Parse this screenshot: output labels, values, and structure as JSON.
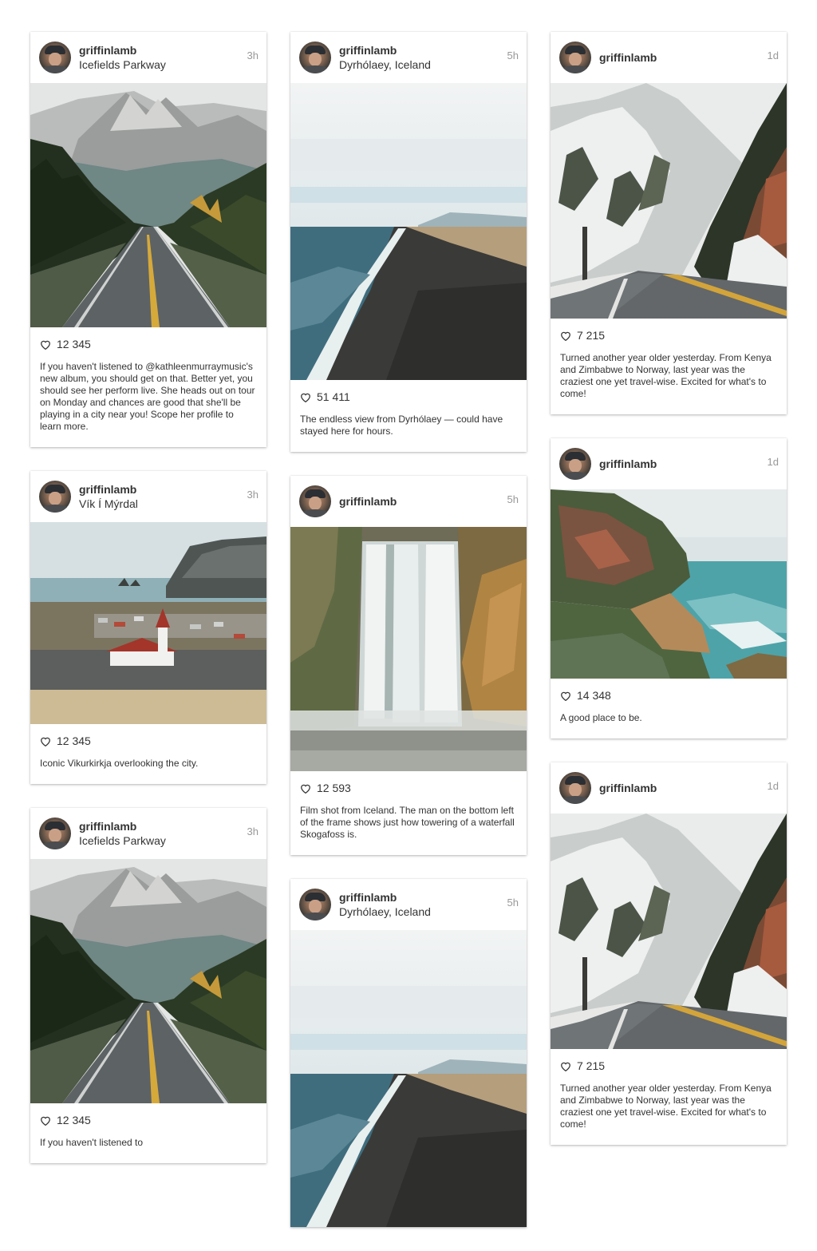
{
  "columns": [
    {
      "cards": [
        {
          "user": "griffinlamb",
          "location": "Icefields Parkway",
          "time": "3h",
          "likes": "12 345",
          "caption": "If you haven't listened to @kathleenmurraymusic's new album, you should get on that. Better yet, you should see her perform live. She heads out on tour on Monday and chances are good that she'll be playing in a city near you! Scope her profile to learn more.",
          "photo": "mountain-road-photo"
        },
        {
          "user": "griffinlamb",
          "location": "Vík Í Mýrdal",
          "time": "3h",
          "likes": "12 345",
          "caption": "Iconic Vikurkirkja overlooking the city.",
          "photo": "church-village-photo"
        },
        {
          "user": "griffinlamb",
          "location": "Icefields Parkway",
          "time": "3h",
          "likes": "12 345",
          "caption": "If you haven't listened to",
          "photo": "mountain-road-photo"
        }
      ]
    },
    {
      "cards": [
        {
          "user": "griffinlamb",
          "location": "Dyrhólaey, Iceland",
          "time": "5h",
          "likes": "51 411",
          "caption": "The endless view from Dyrhólaey — could have stayed here for hours.",
          "photo": "black-beach-photo"
        },
        {
          "user": "griffinlamb",
          "location": "",
          "time": "5h",
          "likes": "12 593",
          "caption": "Film shot from Iceland. The man on the bottom left of the frame shows just how towering of a waterfall Skogafoss is.",
          "photo": "waterfall-photo"
        },
        {
          "user": "griffinlamb",
          "location": "Dyrhólaey, Iceland",
          "time": "5h",
          "likes": "",
          "caption": "",
          "photo": "black-beach-photo"
        }
      ]
    },
    {
      "cards": [
        {
          "user": "griffinlamb",
          "location": "",
          "time": "1d",
          "likes": "7 215",
          "caption": "Turned another year older yesterday. From Kenya and Zimbabwe to Norway, last year was the craziest one yet travel-wise. Excited for what's to come!",
          "photo": "snowy-mountain-road-photo"
        },
        {
          "user": "griffinlamb",
          "location": "",
          "time": "1d",
          "likes": "14 348",
          "caption": "A good place to be.",
          "photo": "sea-cliff-photo"
        },
        {
          "user": "griffinlamb",
          "location": "",
          "time": "1d",
          "likes": "7 215",
          "caption": "Turned another year older yesterday. From Kenya and Zimbabwe to Norway, last year was the craziest one yet travel-wise. Excited for what's to come!",
          "photo": "snowy-mountain-road-photo"
        }
      ]
    }
  ],
  "icons": {
    "avatar": "avatar-image",
    "like": "heart-icon"
  },
  "colors": {
    "text": "#333333",
    "muted": "#999999",
    "background": "#ffffff"
  }
}
